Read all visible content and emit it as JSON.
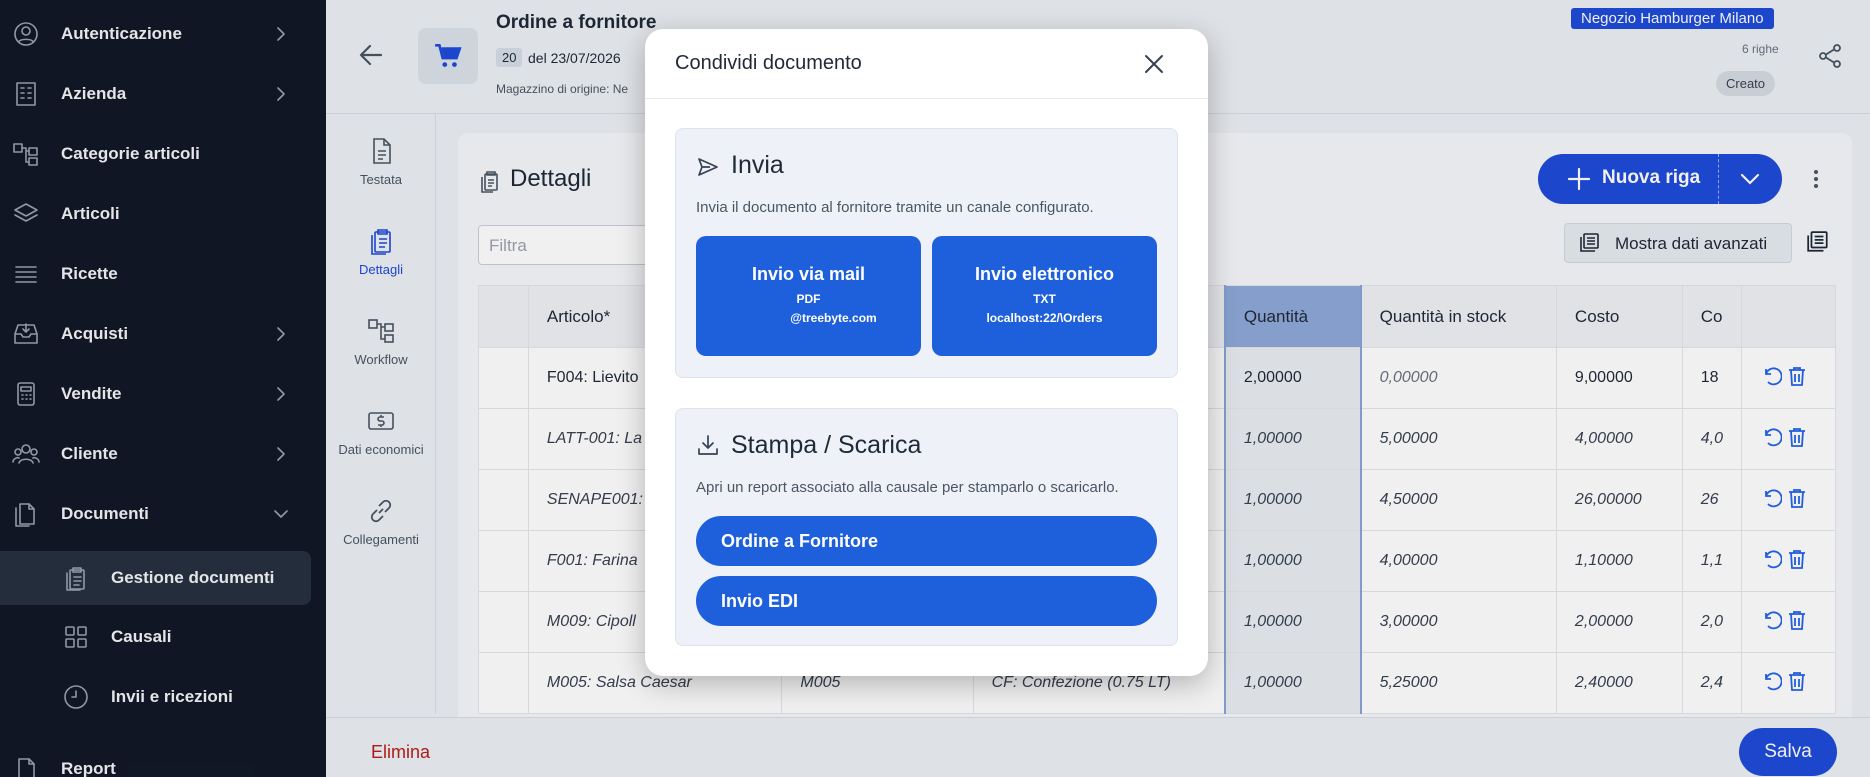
{
  "sidebar": {
    "items": [
      {
        "label": "Autenticazione",
        "icon": "user-circle-icon",
        "expandable": true
      },
      {
        "label": "Azienda",
        "icon": "building-icon",
        "expandable": true
      },
      {
        "label": "Categorie articoli",
        "icon": "hierarchy-icon",
        "expandable": false
      },
      {
        "label": "Articoli",
        "icon": "layers-icon",
        "expandable": false
      },
      {
        "label": "Ricette",
        "icon": "list-icon",
        "expandable": false
      },
      {
        "label": "Acquisti",
        "icon": "inbox-icon",
        "expandable": true
      },
      {
        "label": "Vendite",
        "icon": "calculator-icon",
        "expandable": true
      },
      {
        "label": "Cliente",
        "icon": "users-icon",
        "expandable": true
      },
      {
        "label": "Documenti",
        "icon": "documents-icon",
        "expandable": true,
        "expanded": true
      },
      {
        "label": "Report",
        "icon": "report-icon",
        "expandable": false
      }
    ],
    "sub_items": [
      {
        "label": "Gestione documenti",
        "icon": "clipboard-icon",
        "active": true
      },
      {
        "label": "Causali",
        "icon": "grid-icon"
      },
      {
        "label": "Invii e ricezioni",
        "icon": "clock-icon"
      }
    ]
  },
  "header": {
    "title": "Ordine a fornitore",
    "number": "20",
    "date": "del 23/07/2026",
    "warehouse": "Magazzino di origine: Ne",
    "shop": "Negozio Hamburger Milano",
    "rows_count": "6 righe",
    "status": "Creato"
  },
  "vtabs": [
    {
      "label": "Testata",
      "icon": "document-icon"
    },
    {
      "label": "Dettagli",
      "icon": "clipboard-list-icon",
      "active": true
    },
    {
      "label": "Workflow",
      "icon": "workflow-icon"
    },
    {
      "label": "Dati economici",
      "icon": "money-icon"
    },
    {
      "label": "Collegamenti",
      "icon": "link-icon"
    }
  ],
  "details": {
    "title": "Dettagli",
    "new_row_label": "Nuova riga",
    "filter_placeholder": "Filtra",
    "advanced_label": "Mostra dati avanzati",
    "columns": [
      "Articolo*",
      "",
      "",
      "Quantità",
      "Quantità in stock",
      "Costo",
      "Co"
    ],
    "rows": [
      {
        "articolo": "F004: Lievito",
        "code": "",
        "conf": "",
        "qty": "2,00000",
        "stock": "0,00000",
        "cost": "9,00000",
        "co": "18"
      },
      {
        "articolo": "LATT-001: La",
        "code": "",
        "conf": "",
        "qty": "1,00000",
        "stock": "5,00000",
        "cost": "4,00000",
        "co": "4,0"
      },
      {
        "articolo": "SENAPE001:",
        "code": "",
        "conf": "",
        "qty": "1,00000",
        "stock": "4,50000",
        "cost": "26,00000",
        "co": "26"
      },
      {
        "articolo": "F001: Farina",
        "code": "",
        "conf": "",
        "qty": "1,00000",
        "stock": "4,00000",
        "cost": "1,10000",
        "co": "1,1"
      },
      {
        "articolo": "M009: Cipoll",
        "code": "",
        "conf": "",
        "qty": "1,00000",
        "stock": "3,00000",
        "cost": "2,00000",
        "co": "2,0"
      },
      {
        "articolo": "M005: Salsa Caesar",
        "code": "M005",
        "conf": "CF: Confezione (0.75 LT)",
        "qty": "1,00000",
        "stock": "5,25000",
        "cost": "2,40000",
        "co": "2,4"
      }
    ]
  },
  "footer": {
    "delete_label": "Elimina",
    "save_label": "Salva"
  },
  "modal": {
    "title": "Condividi documento",
    "send": {
      "title": "Invia",
      "description": "Invia il documento al fornitore tramite un canale configurato.",
      "buttons": [
        {
          "label": "Invio via mail",
          "line1": "PDF",
          "line2": "@treebyte.com"
        },
        {
          "label": "Invio elettronico",
          "line1": "TXT",
          "line2": "localhost:22/\\Orders"
        }
      ]
    },
    "print": {
      "title": "Stampa / Scarica",
      "description": "Apri un report associato alla causale per stamparlo o scaricarlo.",
      "buttons": [
        {
          "label": "Ordine a Fornitore"
        },
        {
          "label": "Invio EDI"
        }
      ]
    }
  },
  "colors": {
    "sidebar_bg": "#111827",
    "accent": "#1e4bd8",
    "button_blue": "#1e5fdb",
    "danger": "#b91c1c"
  }
}
